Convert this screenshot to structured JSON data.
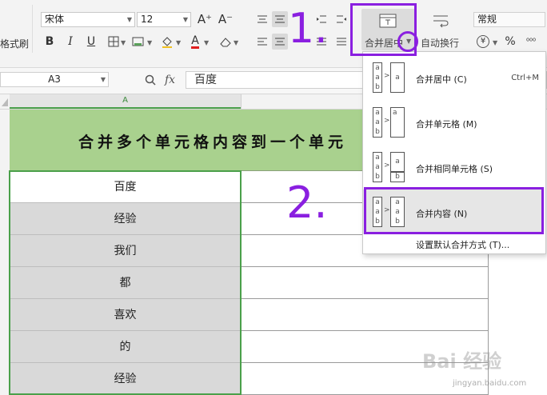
{
  "toolbar": {
    "format_painter_label": "格式刷",
    "font_name": "宋体",
    "font_size": "12",
    "bold": "B",
    "italic": "I",
    "underline": "U",
    "font_color_glyph": "A",
    "grow_font": "A⁺",
    "shrink_font": "A⁻",
    "merge_button_label": "合并居中",
    "wrap_text_label": "自动换行",
    "number_format": "常规",
    "currency_glyph": "¥",
    "percent_glyph": "%",
    "comma_glyph": "⁰⁰⁰"
  },
  "formula_bar": {
    "name_box": "A3",
    "fx_label": "fx",
    "value": "百度"
  },
  "sheet": {
    "column_header": "A",
    "title_cell": "合并多个单元格内容到一个单元",
    "title_bg": "#a9d18e",
    "cells": [
      "百度",
      "经验",
      "我们",
      "都",
      "喜欢",
      "的",
      "经验"
    ]
  },
  "menu": {
    "items": [
      {
        "label": "合并居中 (C)",
        "shortcut": "Ctrl+M"
      },
      {
        "label": "合并单元格 (M)",
        "shortcut": ""
      },
      {
        "label": "合并相同单元格 (S)",
        "shortcut": ""
      },
      {
        "label": "合并内容 (N)",
        "shortcut": ""
      }
    ],
    "footer": "设置默认合并方式 (T)..."
  },
  "annotations": {
    "step1": "1.",
    "step2": "2.",
    "color": "#8a1fe0"
  },
  "watermark": {
    "brand": "Bai 经验",
    "url": "jingyan.baidu.com"
  }
}
